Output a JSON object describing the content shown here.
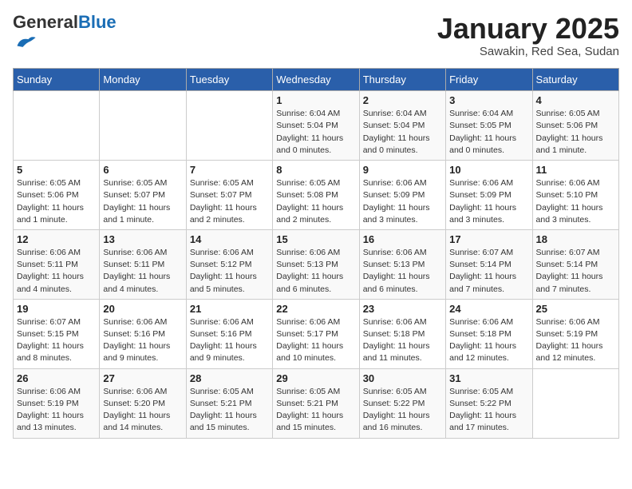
{
  "header": {
    "logo_general": "General",
    "logo_blue": "Blue",
    "month_title": "January 2025",
    "location": "Sawakin, Red Sea, Sudan"
  },
  "days_of_week": [
    "Sunday",
    "Monday",
    "Tuesday",
    "Wednesday",
    "Thursday",
    "Friday",
    "Saturday"
  ],
  "weeks": [
    [
      {
        "num": "",
        "detail": ""
      },
      {
        "num": "",
        "detail": ""
      },
      {
        "num": "",
        "detail": ""
      },
      {
        "num": "1",
        "detail": "Sunrise: 6:04 AM\nSunset: 5:04 PM\nDaylight: 11 hours\nand 0 minutes."
      },
      {
        "num": "2",
        "detail": "Sunrise: 6:04 AM\nSunset: 5:04 PM\nDaylight: 11 hours\nand 0 minutes."
      },
      {
        "num": "3",
        "detail": "Sunrise: 6:04 AM\nSunset: 5:05 PM\nDaylight: 11 hours\nand 0 minutes."
      },
      {
        "num": "4",
        "detail": "Sunrise: 6:05 AM\nSunset: 5:06 PM\nDaylight: 11 hours\nand 1 minute."
      }
    ],
    [
      {
        "num": "5",
        "detail": "Sunrise: 6:05 AM\nSunset: 5:06 PM\nDaylight: 11 hours\nand 1 minute."
      },
      {
        "num": "6",
        "detail": "Sunrise: 6:05 AM\nSunset: 5:07 PM\nDaylight: 11 hours\nand 1 minute."
      },
      {
        "num": "7",
        "detail": "Sunrise: 6:05 AM\nSunset: 5:07 PM\nDaylight: 11 hours\nand 2 minutes."
      },
      {
        "num": "8",
        "detail": "Sunrise: 6:05 AM\nSunset: 5:08 PM\nDaylight: 11 hours\nand 2 minutes."
      },
      {
        "num": "9",
        "detail": "Sunrise: 6:06 AM\nSunset: 5:09 PM\nDaylight: 11 hours\nand 3 minutes."
      },
      {
        "num": "10",
        "detail": "Sunrise: 6:06 AM\nSunset: 5:09 PM\nDaylight: 11 hours\nand 3 minutes."
      },
      {
        "num": "11",
        "detail": "Sunrise: 6:06 AM\nSunset: 5:10 PM\nDaylight: 11 hours\nand 3 minutes."
      }
    ],
    [
      {
        "num": "12",
        "detail": "Sunrise: 6:06 AM\nSunset: 5:11 PM\nDaylight: 11 hours\nand 4 minutes."
      },
      {
        "num": "13",
        "detail": "Sunrise: 6:06 AM\nSunset: 5:11 PM\nDaylight: 11 hours\nand 4 minutes."
      },
      {
        "num": "14",
        "detail": "Sunrise: 6:06 AM\nSunset: 5:12 PM\nDaylight: 11 hours\nand 5 minutes."
      },
      {
        "num": "15",
        "detail": "Sunrise: 6:06 AM\nSunset: 5:13 PM\nDaylight: 11 hours\nand 6 minutes."
      },
      {
        "num": "16",
        "detail": "Sunrise: 6:06 AM\nSunset: 5:13 PM\nDaylight: 11 hours\nand 6 minutes."
      },
      {
        "num": "17",
        "detail": "Sunrise: 6:07 AM\nSunset: 5:14 PM\nDaylight: 11 hours\nand 7 minutes."
      },
      {
        "num": "18",
        "detail": "Sunrise: 6:07 AM\nSunset: 5:14 PM\nDaylight: 11 hours\nand 7 minutes."
      }
    ],
    [
      {
        "num": "19",
        "detail": "Sunrise: 6:07 AM\nSunset: 5:15 PM\nDaylight: 11 hours\nand 8 minutes."
      },
      {
        "num": "20",
        "detail": "Sunrise: 6:06 AM\nSunset: 5:16 PM\nDaylight: 11 hours\nand 9 minutes."
      },
      {
        "num": "21",
        "detail": "Sunrise: 6:06 AM\nSunset: 5:16 PM\nDaylight: 11 hours\nand 9 minutes."
      },
      {
        "num": "22",
        "detail": "Sunrise: 6:06 AM\nSunset: 5:17 PM\nDaylight: 11 hours\nand 10 minutes."
      },
      {
        "num": "23",
        "detail": "Sunrise: 6:06 AM\nSunset: 5:18 PM\nDaylight: 11 hours\nand 11 minutes."
      },
      {
        "num": "24",
        "detail": "Sunrise: 6:06 AM\nSunset: 5:18 PM\nDaylight: 11 hours\nand 12 minutes."
      },
      {
        "num": "25",
        "detail": "Sunrise: 6:06 AM\nSunset: 5:19 PM\nDaylight: 11 hours\nand 12 minutes."
      }
    ],
    [
      {
        "num": "26",
        "detail": "Sunrise: 6:06 AM\nSunset: 5:19 PM\nDaylight: 11 hours\nand 13 minutes."
      },
      {
        "num": "27",
        "detail": "Sunrise: 6:06 AM\nSunset: 5:20 PM\nDaylight: 11 hours\nand 14 minutes."
      },
      {
        "num": "28",
        "detail": "Sunrise: 6:05 AM\nSunset: 5:21 PM\nDaylight: 11 hours\nand 15 minutes."
      },
      {
        "num": "29",
        "detail": "Sunrise: 6:05 AM\nSunset: 5:21 PM\nDaylight: 11 hours\nand 15 minutes."
      },
      {
        "num": "30",
        "detail": "Sunrise: 6:05 AM\nSunset: 5:22 PM\nDaylight: 11 hours\nand 16 minutes."
      },
      {
        "num": "31",
        "detail": "Sunrise: 6:05 AM\nSunset: 5:22 PM\nDaylight: 11 hours\nand 17 minutes."
      },
      {
        "num": "",
        "detail": ""
      }
    ]
  ]
}
